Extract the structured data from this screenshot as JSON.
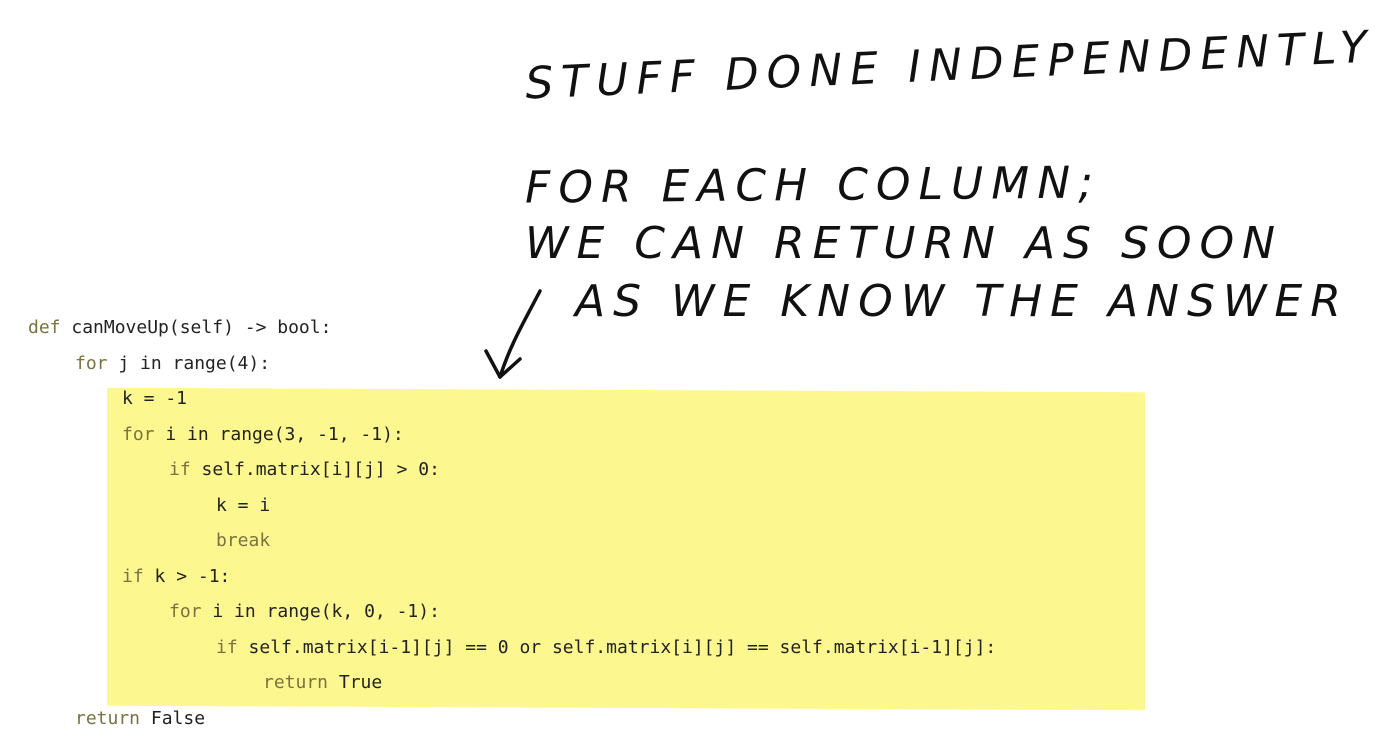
{
  "code": {
    "lines": [
      {
        "indent": 0,
        "kw": "def",
        "rest": " canMoveUp(self) -> bool:"
      },
      {
        "indent": 1,
        "kw": "for",
        "rest": " j in range(4):"
      },
      {
        "indent": 2,
        "kw": "",
        "rest": "k = -1"
      },
      {
        "indent": 2,
        "kw": "for",
        "rest": " i in range(3, -1, -1):"
      },
      {
        "indent": 3,
        "kw": "if",
        "rest": " self.matrix[i][j] > 0:"
      },
      {
        "indent": 4,
        "kw": "",
        "rest": "k = i"
      },
      {
        "indent": 4,
        "kw": "break",
        "rest": ""
      },
      {
        "indent": 2,
        "kw": "if",
        "rest": " k > -1:"
      },
      {
        "indent": 3,
        "kw": "for",
        "rest": " i in range(k, 0, -1):"
      },
      {
        "indent": 4,
        "kw": "if",
        "rest": " self.matrix[i-1][j] == 0 or self.matrix[i][j] == self.matrix[i-1][j]:"
      },
      {
        "indent": 5,
        "kw": "return",
        "rest": " True"
      },
      {
        "indent": 1,
        "kw": "return",
        "rest": " False"
      }
    ]
  },
  "annotation": {
    "line1": "STUFF DONE INDEPENDENTLY",
    "line2": "FOR EACH COLUMN;",
    "line3": "WE CAN RETURN AS SOON",
    "line4": "AS WE KNOW THE ANSWER"
  },
  "colors": {
    "highlight": "#fdf78f",
    "keyword": "#7a7240"
  }
}
